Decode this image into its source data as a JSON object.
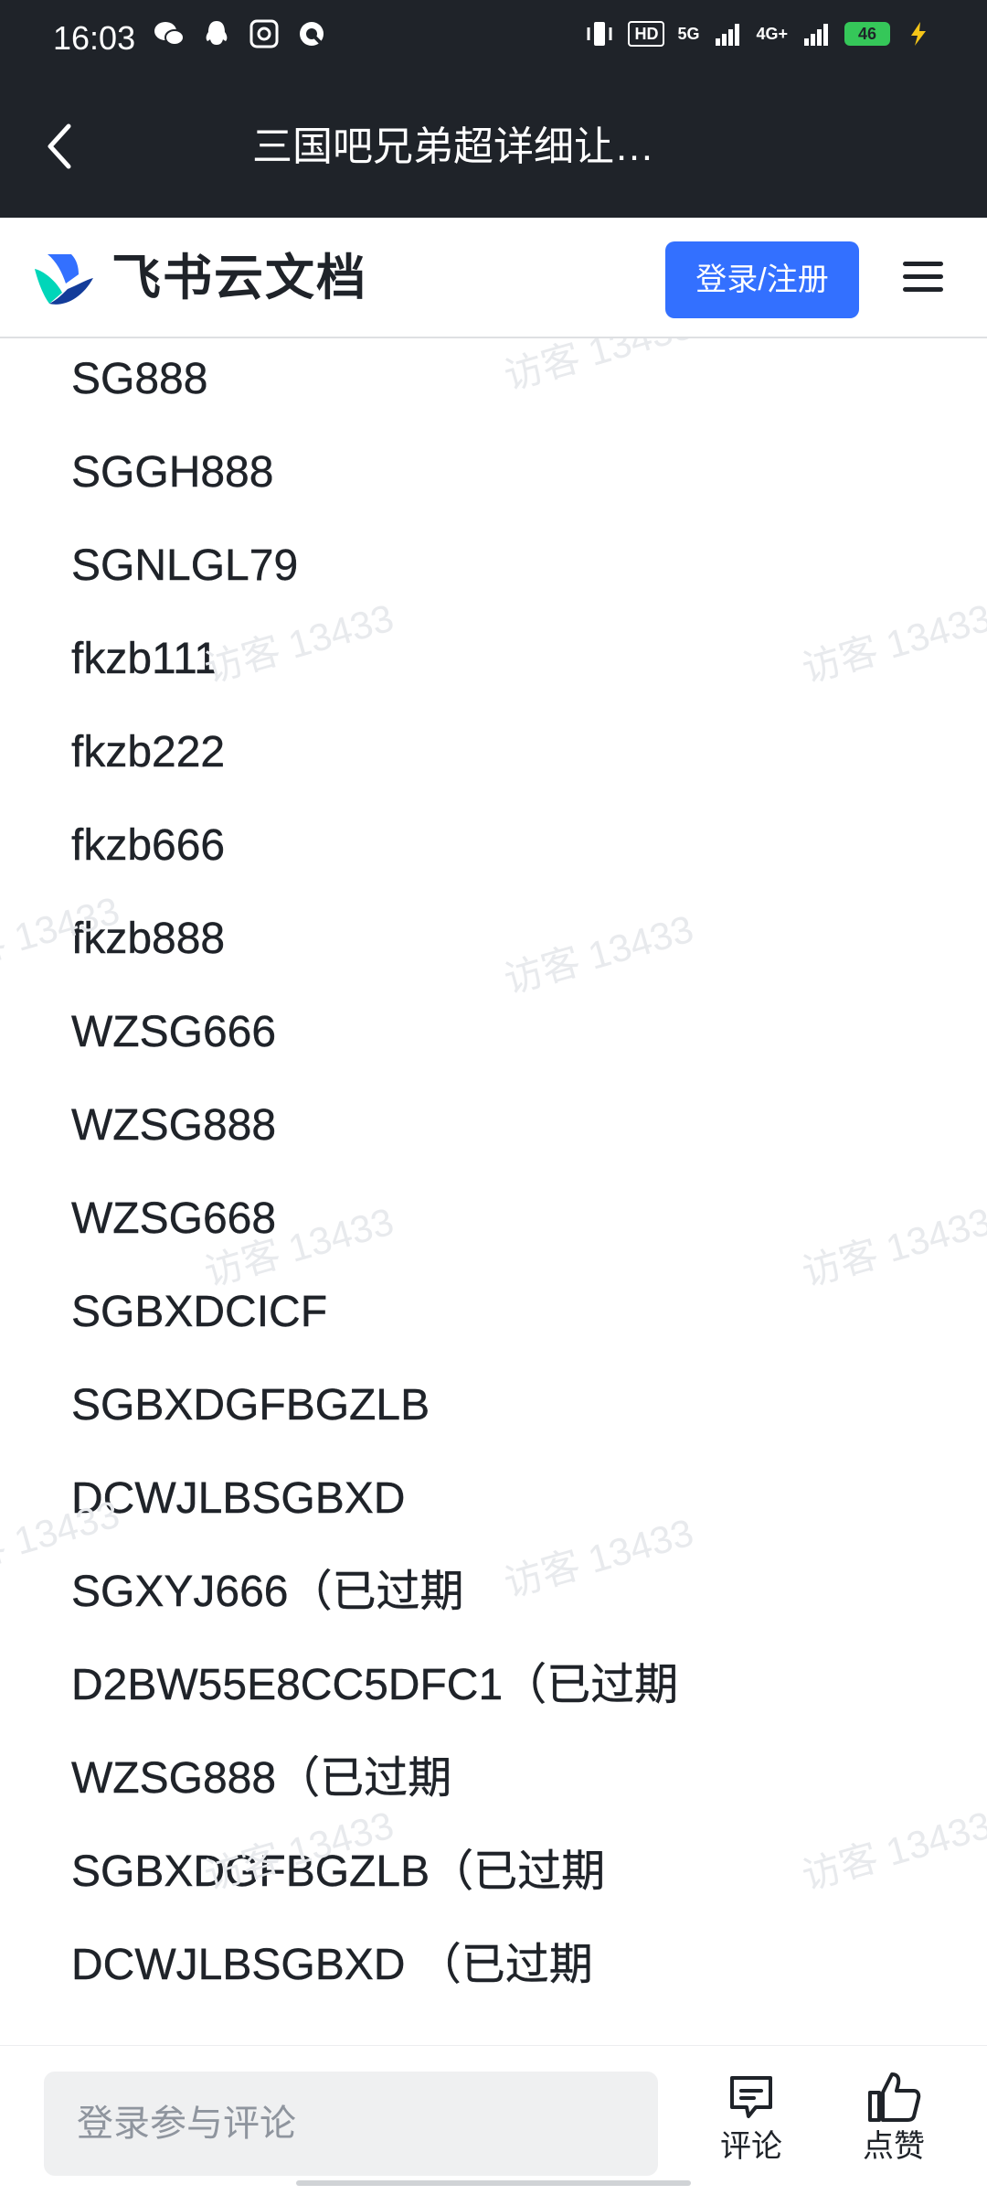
{
  "status_bar": {
    "time": "16:03",
    "network_hd": "HD",
    "network_5g": "5G",
    "network_4g": "4G+",
    "battery": "46"
  },
  "header": {
    "title": "三国吧兄弟超详细让…"
  },
  "feishu_bar": {
    "brand": "飞书云文档",
    "login_label": "登录/注册"
  },
  "codes": [
    "SG888",
    "SGGH888",
    "SGNLGL79",
    "fkzb111",
    "fkzb222",
    "fkzb666",
    "fkzb888",
    "WZSG666",
    "WZSG888",
    "WZSG668",
    "SGBXDCICF",
    "SGBXDGFBGZLB",
    "DCWJLBSGBXD",
    "SGXYJ666（已过期",
    "D2BW55E8CC5DFC1（已过期",
    "WZSG888（已过期",
    "SGBXDGFBGZLB（已过期",
    "DCWJLBSGBXD （已过期"
  ],
  "watermark": "访客 13433",
  "bottom_bar": {
    "comment_placeholder": "登录参与评论",
    "comment_label": "评论",
    "like_label": "点赞"
  }
}
